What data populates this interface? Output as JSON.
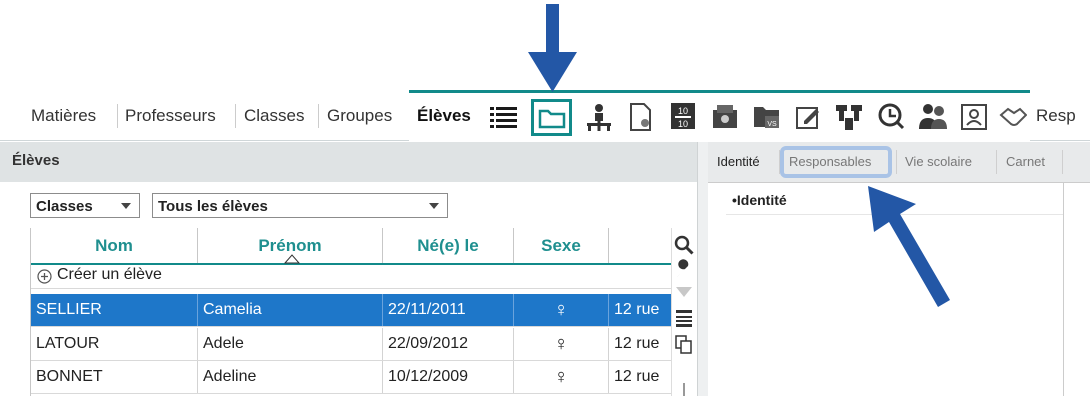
{
  "menu": {
    "items": [
      "Matières",
      "Professeurs",
      "Classes",
      "Groupes",
      "Élèves",
      "Resp"
    ]
  },
  "toolbar_icons": [
    "list-icon",
    "folder-icon",
    "people-tree-icon",
    "document-icon",
    "grades-icon",
    "badge-icon",
    "folder-vs-icon",
    "edit-note-icon",
    "podium-icon",
    "clock-icon",
    "group-icon",
    "portrait-icon",
    "handshake-icon"
  ],
  "left_panel": {
    "title": "Élèves",
    "filter_type": "Classes",
    "filter_value": "Tous les élèves",
    "columns": [
      "Nom",
      "Prénom",
      "Né(e) le",
      "Sexe",
      ""
    ],
    "create_label": "Créer un élève",
    "rows": [
      {
        "nom": "SELLIER",
        "prenom": "Camelia",
        "naissance": "22/11/2011",
        "sexe": "♀",
        "adresse": "12 rue"
      },
      {
        "nom": "LATOUR",
        "prenom": "Adele",
        "naissance": "22/09/2012",
        "sexe": "♀",
        "adresse": "12 rue"
      },
      {
        "nom": "BONNET",
        "prenom": "Adeline",
        "naissance": "10/12/2009",
        "sexe": "♀",
        "adresse": "12 rue"
      }
    ]
  },
  "right_panel": {
    "tabs": [
      "Identité",
      "Responsables",
      "Vie scolaire",
      "Carnet"
    ],
    "section": "Identité"
  },
  "colors": {
    "accent": "#118a8a",
    "selection": "#1e77c9",
    "arrow": "#2357a6",
    "highlight": "#a9c3e6"
  }
}
